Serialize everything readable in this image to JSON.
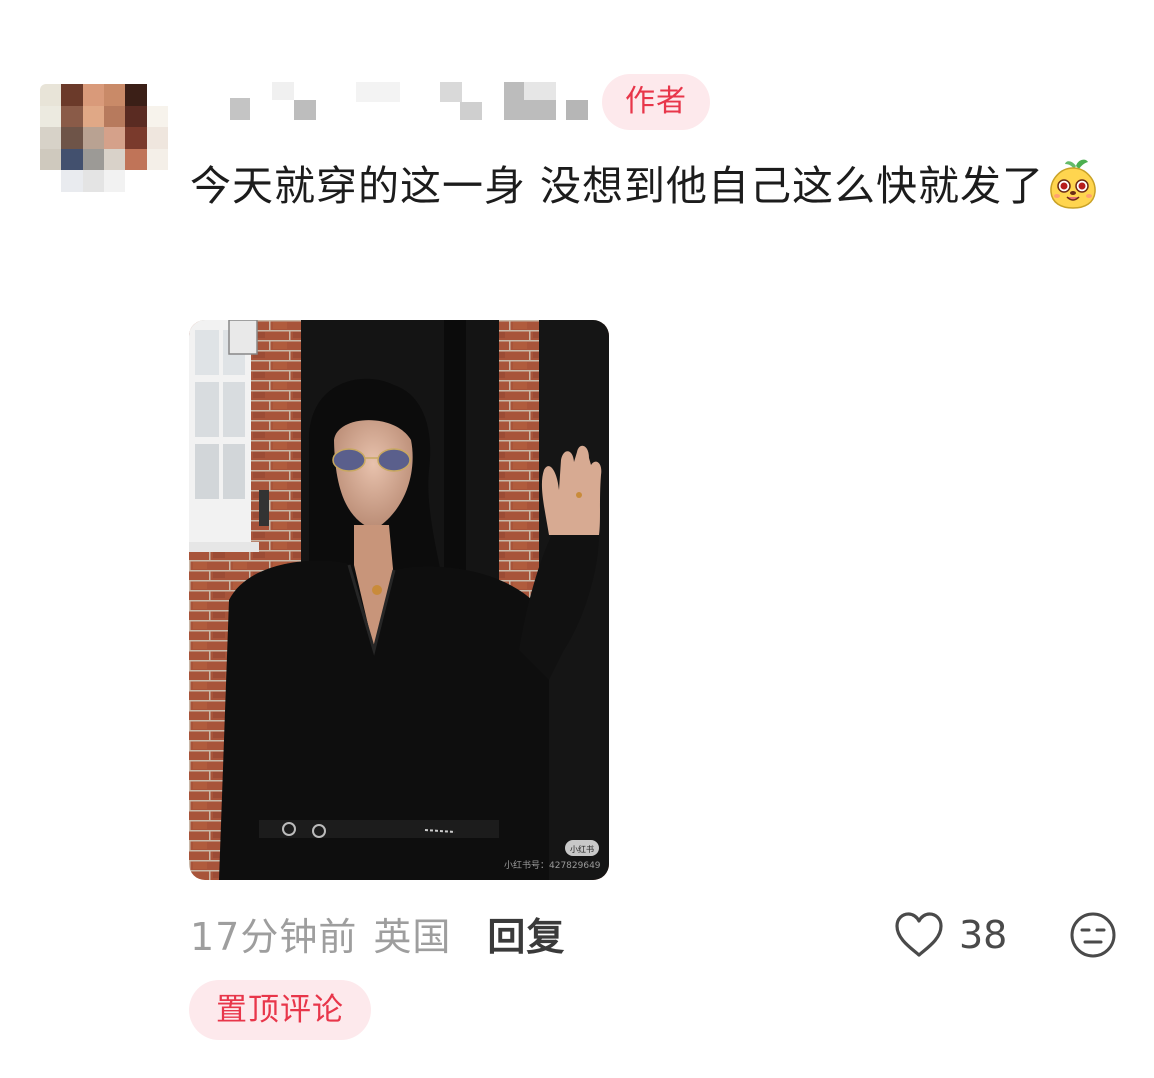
{
  "comment": {
    "author_badge": "作者",
    "text": "今天就穿的这一身 没想到他自己这么快就发了",
    "emoji_icon": "happy-fruit-emoji-icon",
    "photo": {
      "watermark_logo": "小红书",
      "watermark_id": "小红书号：427829649"
    },
    "meta": {
      "time": "17分钟前",
      "location": "英国",
      "reply_label": "回复"
    },
    "likes": {
      "icon": "heart-outline-icon",
      "count": "38"
    },
    "dislike_icon": "expressionless-face-icon",
    "pinned_label": "置顶评论"
  },
  "colors": {
    "accent": "#e8364a",
    "badge_bg": "#fde9ec",
    "meta_text": "#9e9e9e",
    "body_text": "#1c1c1c"
  }
}
